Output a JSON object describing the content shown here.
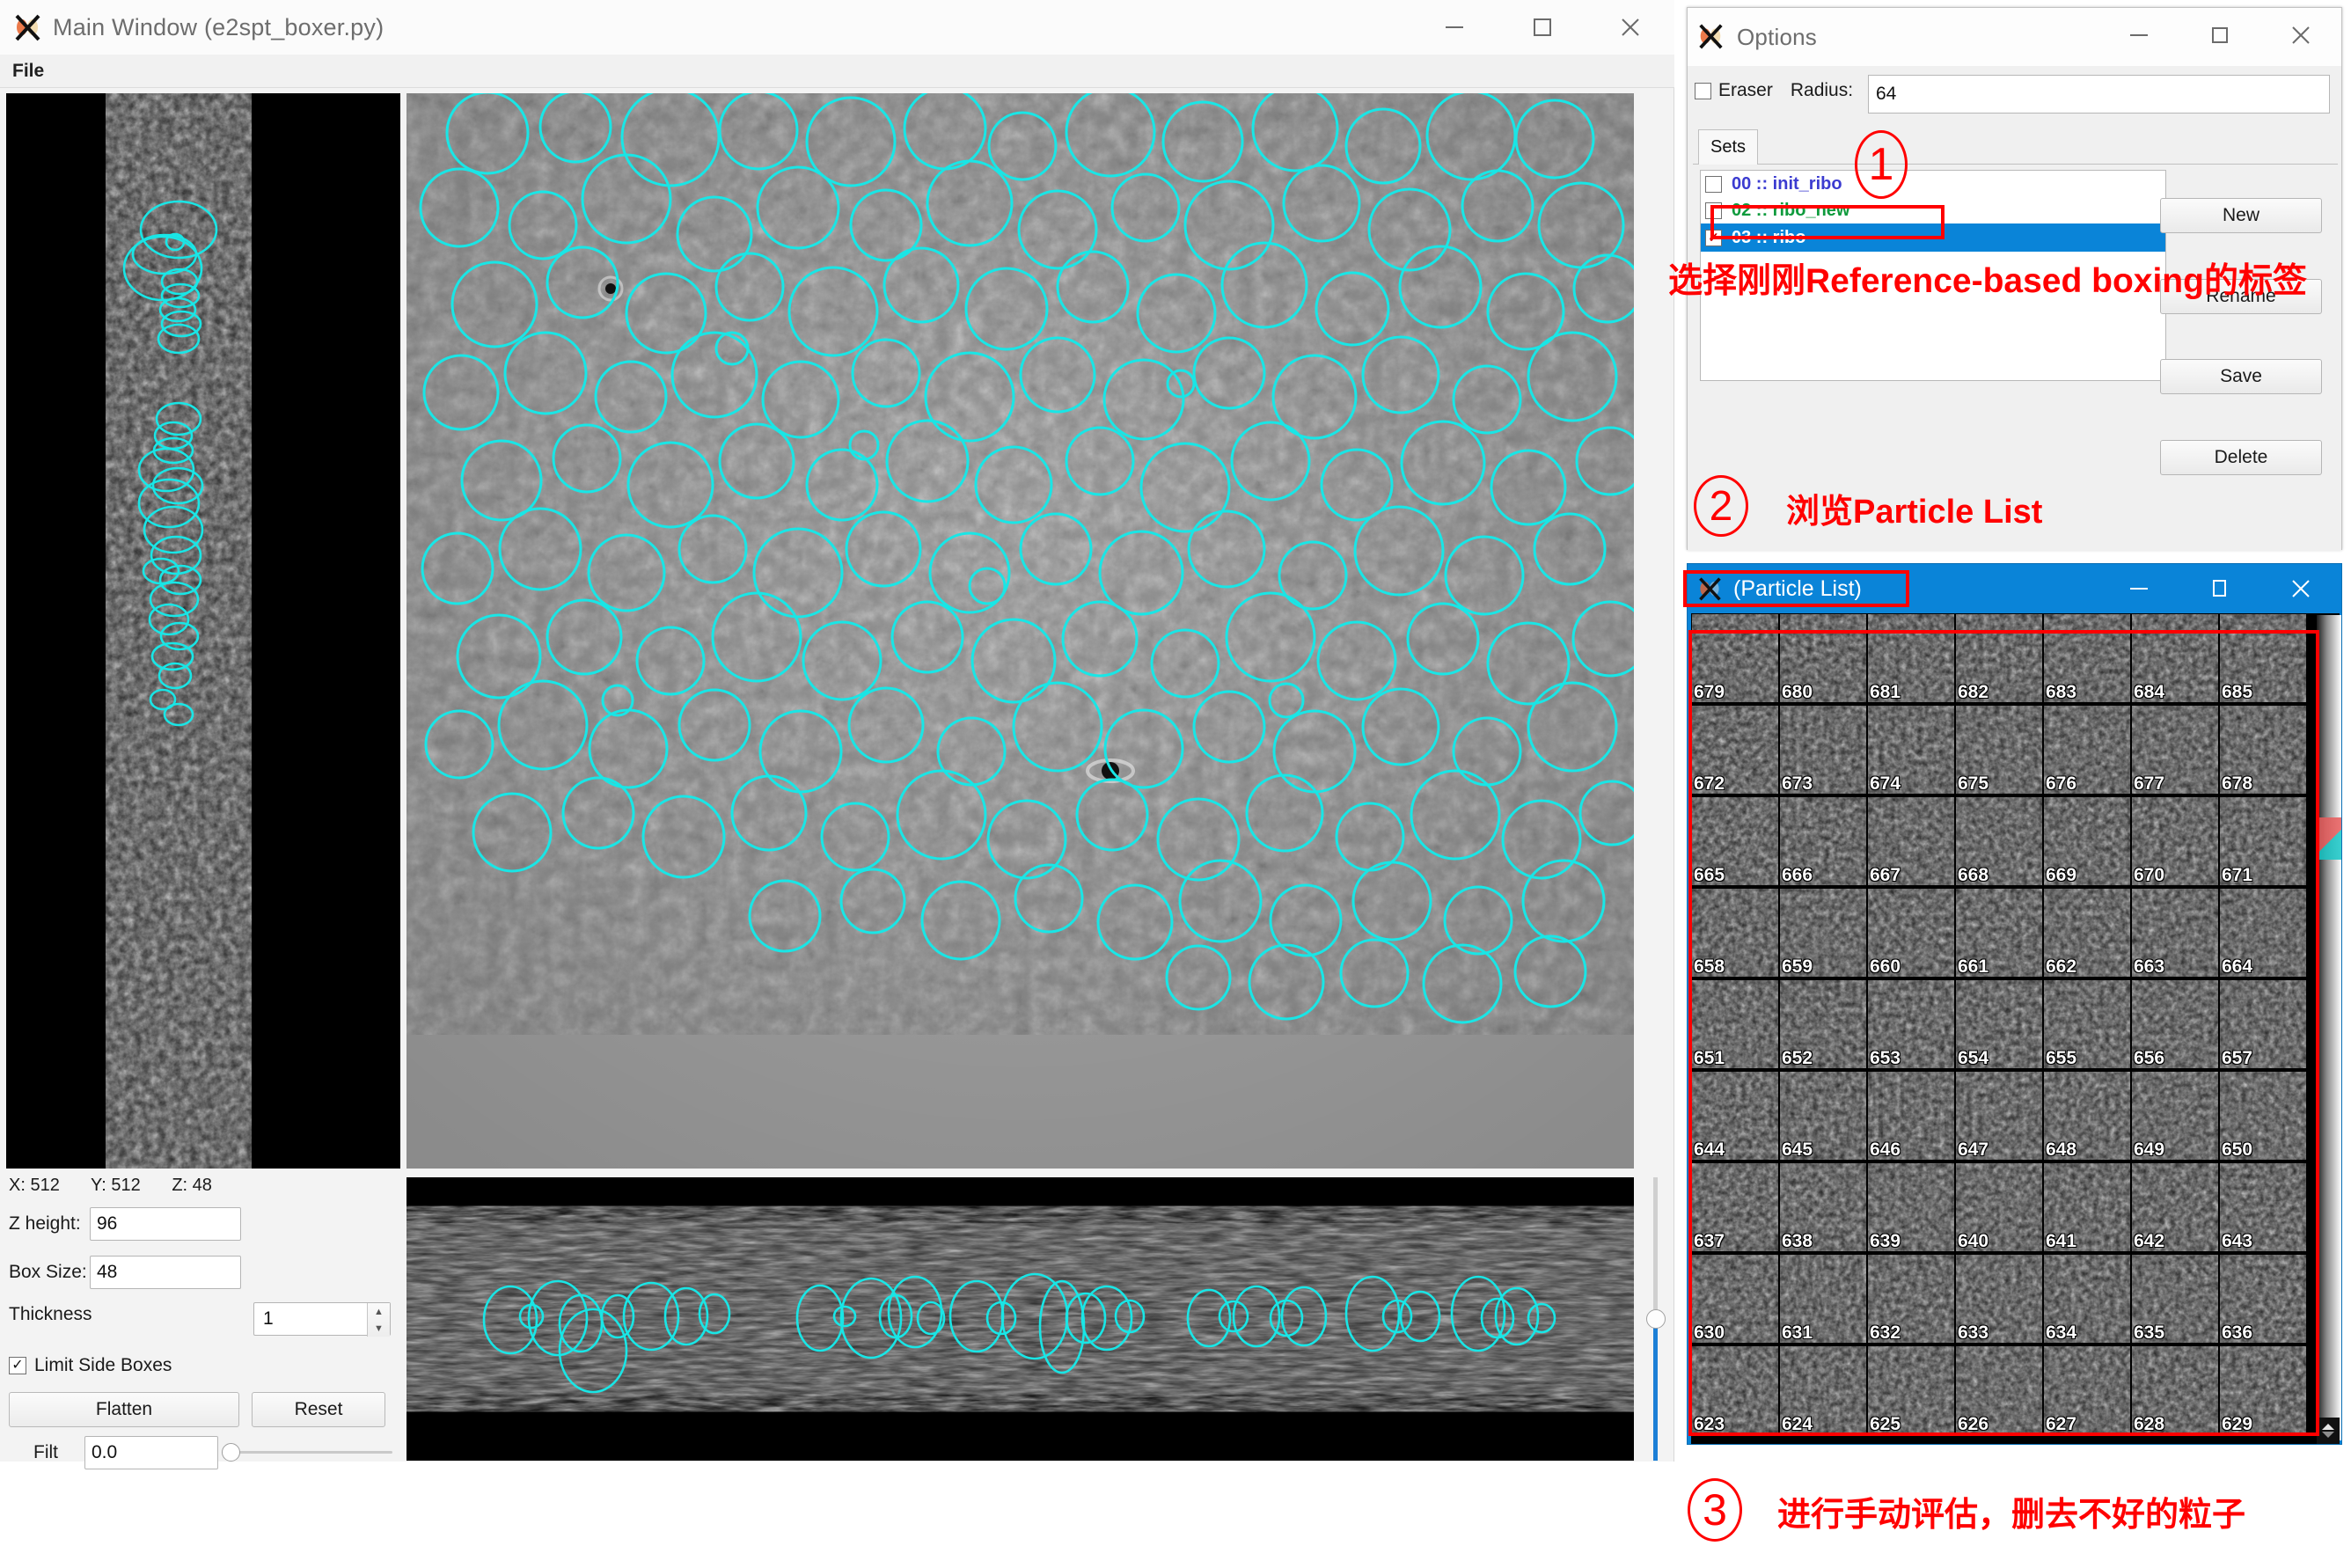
{
  "main_window": {
    "title": "Main Window (e2spt_boxer.py)",
    "icon": "app-x-icon",
    "menu": {
      "file": "File"
    },
    "controls": {
      "minimize": "—",
      "maximize": "☐",
      "close": "✕"
    },
    "status": {
      "x": "X: 512",
      "y": "Y: 512",
      "z": "Z: 48"
    },
    "fields": {
      "z_height_label": "Z height:",
      "z_height_value": "96",
      "box_size_label": "Box Size:",
      "box_size_value": "48",
      "thickness_label": "Thickness",
      "thickness_value": "1",
      "limit_side_boxes_label": "Limit Side Boxes",
      "limit_side_boxes_checked": "✓",
      "flatten_label": "Flatten",
      "reset_label": "Reset",
      "filt_label": "Filt",
      "filt_value": "0.0"
    }
  },
  "options_window": {
    "title": "Options",
    "icon": "app-x-icon",
    "controls": {
      "minimize": "—",
      "maximize": "☐",
      "close": "✕"
    },
    "eraser_label": "Eraser",
    "eraser_checked": "",
    "radius_label": "Radius:",
    "radius_value": "64",
    "tab_sets": "Sets",
    "sets": [
      {
        "label": "00 :: init_ribo",
        "color": "#3b3bd0",
        "checked": "",
        "selected": false
      },
      {
        "label": "02 :: ribo_new",
        "color": "#0f9b3d",
        "checked": "",
        "selected": false
      },
      {
        "label": "03 :: ribo",
        "color": "#ffffff",
        "checked": "✓",
        "selected": true
      }
    ],
    "buttons": {
      "new": "New",
      "rename": "Rename",
      "save": "Save",
      "delete": "Delete"
    }
  },
  "particle_list_window": {
    "title": "(Particle List)",
    "icon": "app-x-icon",
    "controls": {
      "minimize": "—",
      "maximize": "☐",
      "close": "✕"
    },
    "grid": {
      "columns": 7,
      "rows": [
        [
          "679",
          "680",
          "681",
          "682",
          "683",
          "684",
          "685"
        ],
        [
          "672",
          "673",
          "674",
          "675",
          "676",
          "677",
          "678"
        ],
        [
          "665",
          "666",
          "667",
          "668",
          "669",
          "670",
          "671"
        ],
        [
          "658",
          "659",
          "660",
          "661",
          "662",
          "663",
          "664"
        ],
        [
          "651",
          "652",
          "653",
          "654",
          "655",
          "656",
          "657"
        ],
        [
          "644",
          "645",
          "646",
          "647",
          "648",
          "649",
          "650"
        ],
        [
          "637",
          "638",
          "639",
          "640",
          "641",
          "642",
          "643"
        ],
        [
          "630",
          "631",
          "632",
          "633",
          "634",
          "635",
          "636"
        ],
        [
          "623",
          "624",
          "625",
          "626",
          "627",
          "628",
          "629"
        ]
      ]
    }
  },
  "annotations": {
    "color": "#ff0000",
    "step1": {
      "number": "①",
      "numeral": "1",
      "text": "选择刚刚Reference-based boxing的标签"
    },
    "step2": {
      "number": "②",
      "numeral": "2",
      "text": "浏览Particle List"
    },
    "step3": {
      "number": "③",
      "numeral": "3",
      "text": "进行手动评估，删去不好的粒子"
    }
  },
  "colors": {
    "box_cyan": "#19e6e6",
    "accent_blue": "#0a84d8",
    "annotation_red": "#ff0000"
  }
}
